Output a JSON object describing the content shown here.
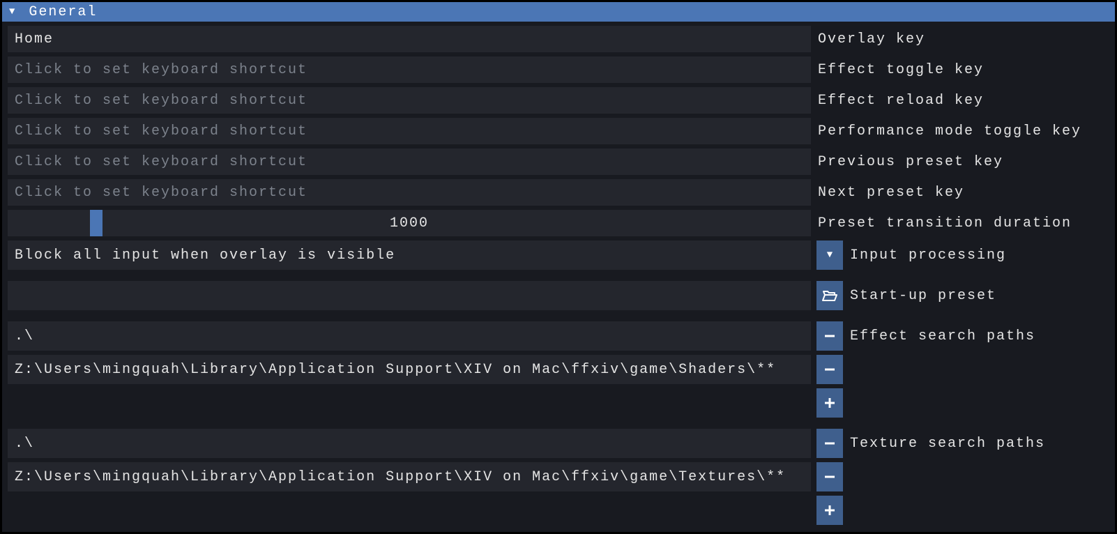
{
  "header": {
    "title": "General"
  },
  "placeholder": "Click to set keyboard shortcut",
  "keys": {
    "overlay": {
      "label": "Overlay key",
      "value": "Home"
    },
    "toggle": {
      "label": "Effect toggle key",
      "value": ""
    },
    "reload": {
      "label": "Effect reload key",
      "value": ""
    },
    "perf": {
      "label": "Performance mode toggle key",
      "value": ""
    },
    "prev": {
      "label": "Previous preset key",
      "value": ""
    },
    "next": {
      "label": "Next preset key",
      "value": ""
    }
  },
  "transition": {
    "label": "Preset transition duration",
    "value": "1000",
    "thumb_pct": 10.2
  },
  "input_processing": {
    "label": "Input processing",
    "selected": "Block all input when overlay is visible"
  },
  "startup_preset": {
    "label": "Start-up preset",
    "value": ""
  },
  "effect_paths": {
    "label": "Effect search paths",
    "items": [
      ".\\",
      "Z:\\Users\\mingquah\\Library\\Application Support\\XIV on Mac\\ffxiv\\game\\Shaders\\**"
    ]
  },
  "texture_paths": {
    "label": "Texture search paths",
    "items": [
      ".\\",
      "Z:\\Users\\mingquah\\Library\\Application Support\\XIV on Mac\\ffxiv\\game\\Textures\\**"
    ]
  }
}
